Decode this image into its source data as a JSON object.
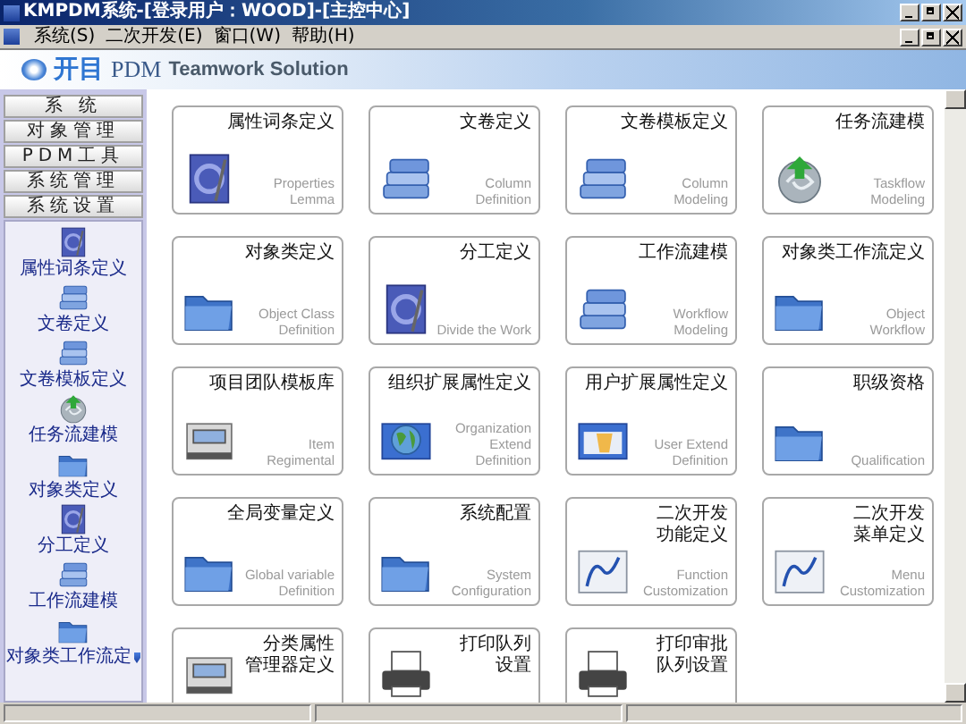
{
  "window": {
    "title": "KMPDM系统-[登录用户：WOOD]-[主控中心]"
  },
  "menu": [
    "系统(S)",
    "二次开发(E)",
    "窗口(W)",
    "帮助(H)"
  ],
  "banner": {
    "logo": "开目",
    "product": "PDM",
    "tagline": "Teamwork Solution"
  },
  "sidebar": {
    "sections": [
      "系 统",
      "对象管理",
      "PDM工具",
      "系统管理",
      "系统设置"
    ],
    "items": [
      {
        "label": "属性词条定义",
        "kind": "document"
      },
      {
        "label": "文卷定义",
        "kind": "books"
      },
      {
        "label": "文卷模板定义",
        "kind": "books"
      },
      {
        "label": "任务流建模",
        "kind": "sphere"
      },
      {
        "label": "对象类定义",
        "kind": "folder"
      },
      {
        "label": "分工定义",
        "kind": "document"
      },
      {
        "label": "工作流建模",
        "kind": "books"
      },
      {
        "label": "对象类工作流定",
        "kind": "folder"
      }
    ]
  },
  "modules": [
    {
      "title": [
        "属性词条定义"
      ],
      "subtitle": "Properties Lemma",
      "kind": "document"
    },
    {
      "title": [
        "文卷定义"
      ],
      "subtitle": "Column Definition",
      "kind": "books"
    },
    {
      "title": [
        "文卷模板定义"
      ],
      "subtitle": "Column Modeling",
      "kind": "books"
    },
    {
      "title": [
        "任务流建模"
      ],
      "subtitle": "Taskflow Modeling",
      "kind": "sphere"
    },
    {
      "title": [
        "对象类定义"
      ],
      "subtitle": "Object Class Definition",
      "kind": "folder"
    },
    {
      "title": [
        "分工定义"
      ],
      "subtitle": "Divide the Work",
      "kind": "document"
    },
    {
      "title": [
        "工作流建模"
      ],
      "subtitle": "Workflow Modeling",
      "kind": "books"
    },
    {
      "title": [
        "对象类工作流定义"
      ],
      "subtitle": "Object Workflow",
      "kind": "folder"
    },
    {
      "title": [
        "项目团队模板库"
      ],
      "subtitle": "Item Regimental",
      "kind": "drawer"
    },
    {
      "title": [
        "组织扩展属性定义"
      ],
      "subtitle": "Organization Extend Definition",
      "kind": "globe"
    },
    {
      "title": [
        "用户扩展属性定义"
      ],
      "subtitle": "User Extend Definition",
      "kind": "window"
    },
    {
      "title": [
        "职级资格"
      ],
      "subtitle": "Qualification",
      "kind": "folder"
    },
    {
      "title": [
        "全局变量定义"
      ],
      "subtitle": "Global variable Definition",
      "kind": "folder"
    },
    {
      "title": [
        "系统配置"
      ],
      "subtitle": "System Configuration",
      "kind": "folder"
    },
    {
      "title": [
        "二次开发",
        "功能定义"
      ],
      "subtitle": "Function Customization",
      "kind": "fx"
    },
    {
      "title": [
        "二次开发",
        "菜单定义"
      ],
      "subtitle": "Menu Customization",
      "kind": "fx"
    },
    {
      "title": [
        "分类属性",
        "管理器定义"
      ],
      "kind": "drawer"
    },
    {
      "title": [
        "打印队列",
        "设置"
      ],
      "kind": "printer"
    },
    {
      "title": [
        "打印审批",
        "队列设置"
      ],
      "kind": "printer"
    }
  ]
}
